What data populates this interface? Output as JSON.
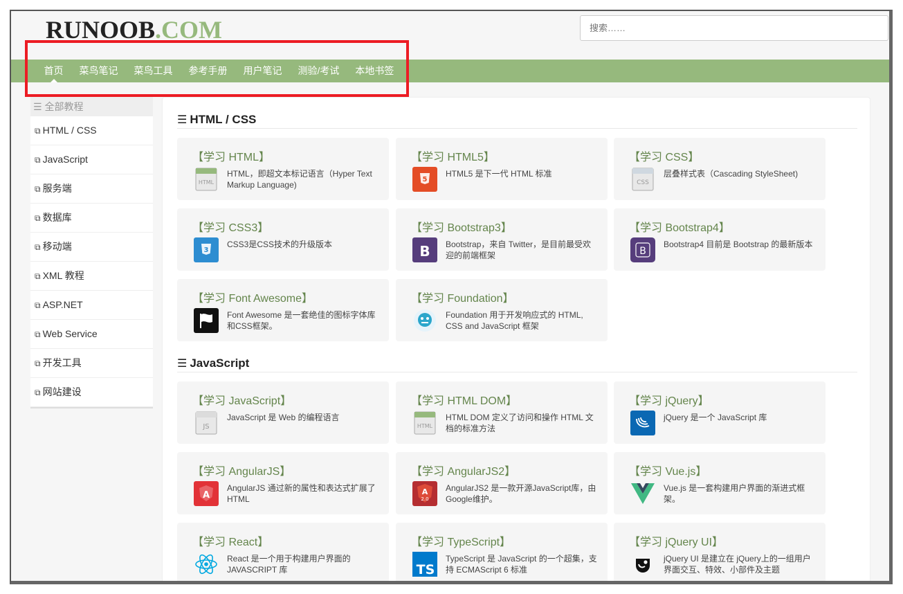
{
  "header": {
    "logo_main": "RUNOOB",
    "logo_suffix": ".COM",
    "search_placeholder": "搜索……"
  },
  "nav": {
    "items": [
      "首页",
      "菜鸟笔记",
      "菜鸟工具",
      "参考手册",
      "用户笔记",
      "测验/考试",
      "本地书签"
    ],
    "active_index": 0
  },
  "sidebar": {
    "title": "全部教程",
    "items": [
      "HTML / CSS",
      "JavaScript",
      "服务端",
      "数据库",
      "移动端",
      "XML 教程",
      "ASP.NET",
      "Web Service",
      "开发工具",
      "网站建设"
    ]
  },
  "sections": [
    {
      "title": "HTML / CSS",
      "cards": [
        {
          "title": "【学习 HTML】",
          "desc": "HTML，即超文本标记语言（Hyper Text Markup Language)",
          "icon": "html-icon"
        },
        {
          "title": "【学习 HTML5】",
          "desc": "HTML5 是下一代 HTML 标准",
          "icon": "html5-icon"
        },
        {
          "title": "【学习 CSS】",
          "desc": "层叠样式表（Cascading StyleSheet)",
          "icon": "css-icon"
        },
        {
          "title": "【学习 CSS3】",
          "desc": "CSS3是CSS技术的升级版本",
          "icon": "css3-icon"
        },
        {
          "title": "【学习 Bootstrap3】",
          "desc": "Bootstrap，来自 Twitter，是目前最受欢迎的前端框架",
          "icon": "bootstrap3-icon"
        },
        {
          "title": "【学习 Bootstrap4】",
          "desc": "Bootstrap4 目前是 Bootstrap 的最新版本",
          "icon": "bootstrap4-icon"
        },
        {
          "title": "【学习 Font Awesome】",
          "desc": "Font Awesome 是一套绝佳的图标字体库和CSS框架。",
          "icon": "font-awesome-icon"
        },
        {
          "title": "【学习 Foundation】",
          "desc": "Foundation 用于开发响应式的 HTML, CSS and JavaScript 框架",
          "icon": "foundation-icon"
        }
      ]
    },
    {
      "title": "JavaScript",
      "cards": [
        {
          "title": "【学习 JavaScript】",
          "desc": "JavaScript 是 Web 的编程语言",
          "icon": "javascript-icon"
        },
        {
          "title": "【学习 HTML DOM】",
          "desc": "HTML DOM 定义了访问和操作 HTML 文档的标准方法",
          "icon": "html-dom-icon"
        },
        {
          "title": "【学习 jQuery】",
          "desc": "jQuery 是一个 JavaScript 库",
          "icon": "jquery-icon"
        },
        {
          "title": "【学习 AngularJS】",
          "desc": "AngularJS 通过新的属性和表达式扩展了 HTML",
          "icon": "angularjs-icon"
        },
        {
          "title": "【学习 AngularJS2】",
          "desc": "AngularJS2 是一款开源JavaScript库，由Google维护。",
          "icon": "angularjs2-icon"
        },
        {
          "title": "【学习 Vue.js】",
          "desc": "Vue.js 是一套构建用户界面的渐进式框架。",
          "icon": "vuejs-icon"
        },
        {
          "title": "【学习 React】",
          "desc": "React 是一个用于构建用户界面的 JAVASCRIPT 库",
          "icon": "react-icon"
        },
        {
          "title": "【学习 TypeScript】",
          "desc": "TypeScript 是 JavaScript 的一个超集，支持 ECMAScript 6 标准",
          "icon": "typescript-icon"
        },
        {
          "title": "【学习 jQuery UI】",
          "desc": "jQuery UI 是建立在 jQuery上的一组用户界面交互、特效、小部件及主题",
          "icon": "jquery-ui-icon"
        }
      ]
    }
  ],
  "colors": {
    "accent": "#96b97d",
    "card_title": "#64854c",
    "highlight": "#ec1c24"
  }
}
